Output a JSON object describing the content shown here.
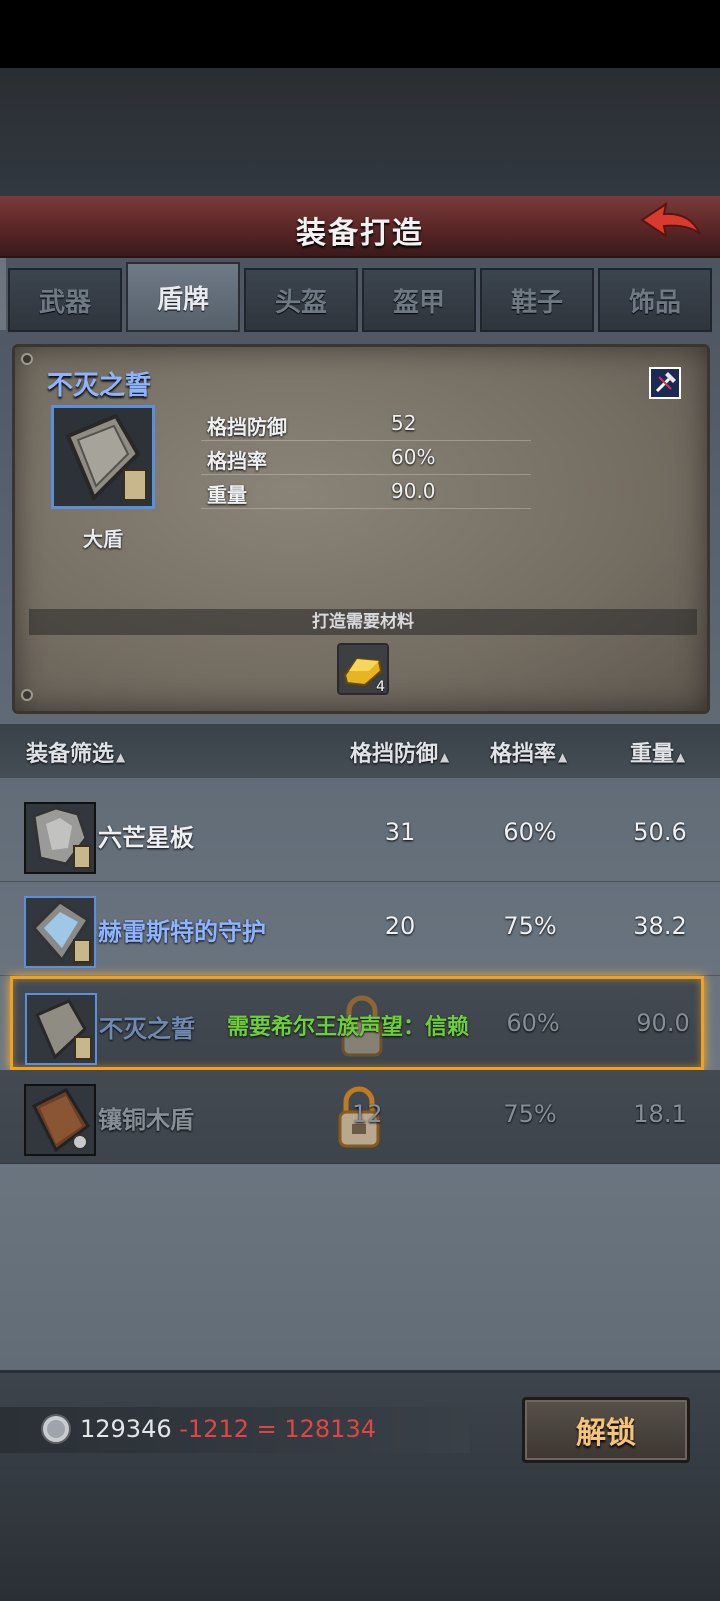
{
  "header": {
    "title": "装备打造"
  },
  "tabs": [
    {
      "label": "武器"
    },
    {
      "label": "盾牌"
    },
    {
      "label": "头盔"
    },
    {
      "label": "盔甲"
    },
    {
      "label": "鞋子"
    },
    {
      "label": "饰品"
    }
  ],
  "active_tab": "盾牌",
  "detail": {
    "title": "不灭之誓",
    "type_label": "大盾",
    "stats": [
      {
        "label": "格挡防御",
        "value": "52"
      },
      {
        "label": "格挡率",
        "value": "60%"
      },
      {
        "label": "重量",
        "value": "90.0"
      }
    ],
    "materials_label": "打造需要材料",
    "material_count": "4"
  },
  "list_header": {
    "filter": "装备筛选",
    "col1": "格挡防御",
    "col2": "格挡率",
    "col3": "重量"
  },
  "rows": [
    {
      "name": "六芒星板",
      "block_def": "31",
      "block_rate": "60%",
      "weight": "50.6"
    },
    {
      "name": "赫雷斯特的守护",
      "block_def": "20",
      "block_rate": "75%",
      "weight": "38.2"
    },
    {
      "name": "不灭之誓",
      "block_def": "",
      "block_rate": "60%",
      "weight": "90.0",
      "requirement": "需要希尔王族声望：信赖"
    },
    {
      "name": "镶铜木盾",
      "block_def": "12",
      "block_rate": "75%",
      "weight": "18.1"
    }
  ],
  "bottom": {
    "current": "129346",
    "cost": "-1212 = 128134",
    "button": "解锁"
  },
  "colors": {
    "accent_blue": "#8fb4ff",
    "selection": "#f0a21e",
    "requirement_green": "#6fcf3a",
    "cost_red": "#e04545",
    "button_text": "#f5c47a"
  },
  "icons": [
    "back-arrow-icon",
    "hammer-icon",
    "gold-ingot-icon",
    "lock-icon",
    "silver-coin-icon",
    "shield-icon"
  ]
}
